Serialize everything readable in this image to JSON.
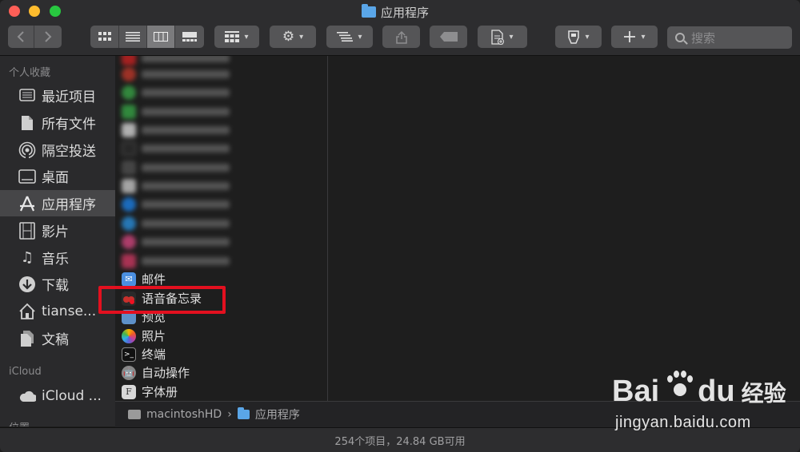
{
  "window": {
    "title": "应用程序"
  },
  "toolbar": {
    "back_icon": "chevron-left-icon",
    "forward_icon": "chevron-right-icon",
    "view_icons": [
      "icon-view-icon",
      "list-view-icon",
      "column-view-icon",
      "gallery-view-icon"
    ],
    "group_icon": "grid-group-icon",
    "action_icon": "gear-icon",
    "arrange_icon": "arrange-lines-icon",
    "share_icon": "share-icon",
    "tag_icon": "tag-icon",
    "new_doc_icon": "new-document-icon",
    "dropbox_icon": "storage-icon",
    "add_icon": "plus-icon",
    "search_placeholder": "搜索"
  },
  "sidebar": {
    "favorites_header": "个人收藏",
    "items": [
      {
        "label": "最近项目",
        "icon": "recents-icon"
      },
      {
        "label": "所有文件",
        "icon": "document-icon"
      },
      {
        "label": "隔空投送",
        "icon": "airdrop-icon"
      },
      {
        "label": "桌面",
        "icon": "desktop-icon"
      },
      {
        "label": "应用程序",
        "icon": "applications-icon",
        "selected": true
      },
      {
        "label": "影片",
        "icon": "film-icon"
      },
      {
        "label": "音乐",
        "icon": "music-icon"
      },
      {
        "label": "下载",
        "icon": "download-icon"
      },
      {
        "label": "tianse...",
        "icon": "home-icon"
      },
      {
        "label": "文稿",
        "icon": "documents-icon"
      }
    ],
    "icloud_header": "iCloud",
    "icloud_items": [
      {
        "label": "iCloud ...",
        "icon": "cloud-icon"
      }
    ],
    "locations_header": "位置"
  },
  "files": {
    "visible": [
      {
        "label": "邮件",
        "icon": "mail-icon"
      },
      {
        "label": "语音备忘录",
        "icon": "voice-memos-icon",
        "highlighted": true
      },
      {
        "label": "预览",
        "icon": "preview-icon"
      },
      {
        "label": "照片",
        "icon": "photos-icon"
      },
      {
        "label": "终端",
        "icon": "terminal-icon"
      },
      {
        "label": "自动操作",
        "icon": "automator-icon"
      },
      {
        "label": "字体册",
        "icon": "font-book-icon"
      }
    ],
    "blurred_icon_colors": [
      "#d22",
      "#d23a2a",
      "#3bb34a",
      "#39b54a",
      "#eeeeee",
      "#2c2c2c",
      "#555555",
      "#dddddd",
      "#1a8cff",
      "#2a9df4",
      "#e84a8a",
      "#e23b6a"
    ]
  },
  "pathbar": {
    "disk": "macintoshHD",
    "folder": "应用程序"
  },
  "status": {
    "text": "254个项目，24.84 GB可用"
  },
  "watermark": {
    "brand": "Bai",
    "brand2": "du",
    "cn": "经验",
    "url": "jingyan.baidu.com"
  }
}
